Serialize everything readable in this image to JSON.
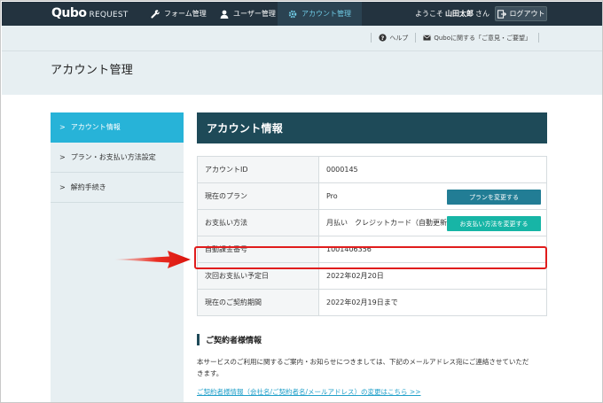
{
  "app": {
    "logo_mark": "Qubo",
    "logo_sub": "REQUEST"
  },
  "topnav": {
    "items": [
      {
        "label": "フォーム管理",
        "icon": "wrench-icon"
      },
      {
        "label": "ユーザー管理",
        "icon": "user-icon"
      },
      {
        "label": "アカウント管理",
        "icon": "gear-icon",
        "active": true
      }
    ],
    "welcome_prefix": "ようこそ",
    "user_name": "山田太郎",
    "welcome_suffix": "さん",
    "logout_label": "ログアウト"
  },
  "utility": {
    "help_label": "ヘルプ",
    "feedback_label": "Quboに関する「ご意見・ご要望」"
  },
  "page": {
    "title": "アカウント管理"
  },
  "sidebar": {
    "items": [
      {
        "label": "アカウント情報",
        "active": true
      },
      {
        "label": "プラン・お支払い方法設定"
      },
      {
        "label": "解約手続き"
      }
    ]
  },
  "main": {
    "header": "アカウント情報",
    "rows": [
      {
        "key": "アカウントID",
        "value": "0000145"
      },
      {
        "key": "現在のプラン",
        "value": "Pro",
        "button": "プランを変更する"
      },
      {
        "key": "お支払い方法",
        "value": "月払い　クレジットカード（自動更新）",
        "button": "お支払い方法を変更する"
      },
      {
        "key": "自動課金番号",
        "value": "1001406356"
      },
      {
        "key": "次回お支払い予定日",
        "value": "2022年02月20日"
      },
      {
        "key": "現在のご契約期間",
        "value": "2022年02月19日まで"
      }
    ],
    "contract_title": "ご契約者様情報",
    "notice_line1": "本サービスのご利用に関するご案内・お知らせにつきましては、下記のメールアドレス宛にご連絡させていただ",
    "notice_line2": "きます。",
    "change_link": "ご契約者様情報（会社名/ご契約者名/メールアドレス）の変更はこちら >>"
  },
  "colors": {
    "topbar": "#23333f",
    "accent": "#27b3d8",
    "header": "#1e4a58",
    "highlight": "#e01c1c"
  }
}
